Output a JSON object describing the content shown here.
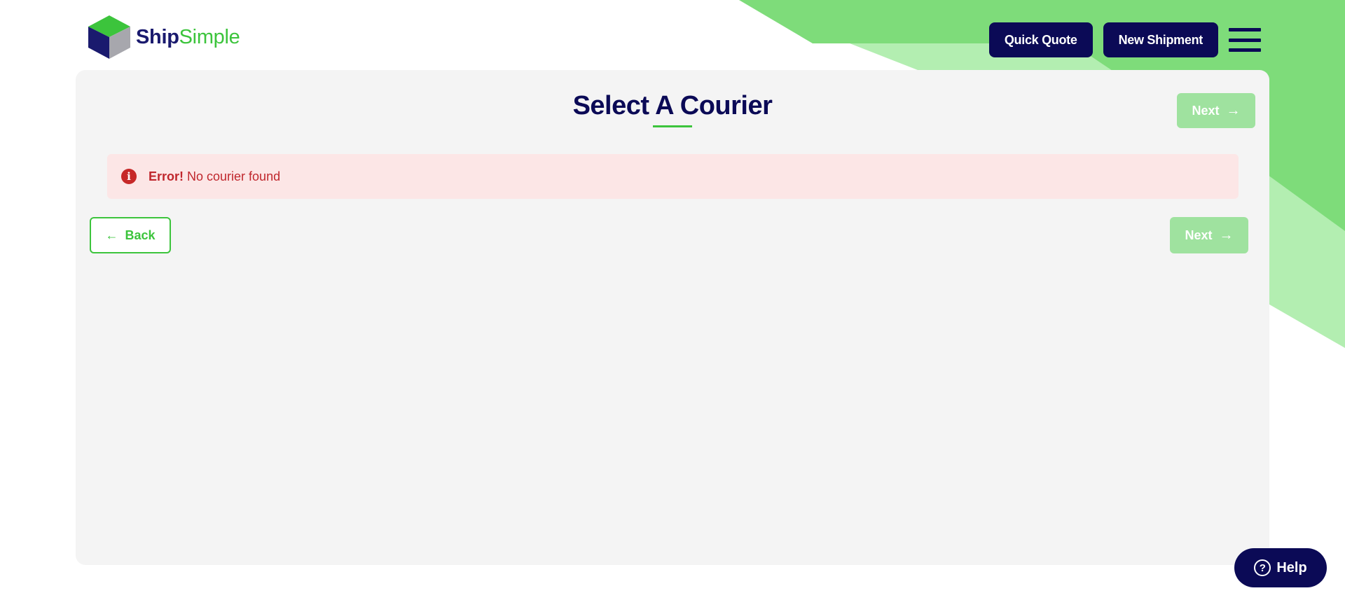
{
  "header": {
    "logo_part1": "Ship",
    "logo_part2": "Simple",
    "quick_quote_label": "Quick Quote",
    "new_shipment_label": "New Shipment"
  },
  "main": {
    "title": "Select A Courier",
    "next_label": "Next",
    "back_label": "Back",
    "alert": {
      "strong": "Error!",
      "message": "No courier found"
    }
  },
  "help": {
    "label": "Help"
  },
  "icons": {
    "menu": "hamburger-icon",
    "alert": "info-icon",
    "next": "arrow-right-icon",
    "back": "arrow-left-icon",
    "help": "question-circle-icon"
  },
  "colors": {
    "navy": "#0b0a56",
    "green": "#3cc43c",
    "light_green": "#7edc7a",
    "pale_green": "#b3eeb1",
    "disabled_green": "#9fe29f",
    "error_bg": "#fce6e6",
    "error_text": "#c0272d",
    "card_bg": "#f4f4f4"
  }
}
